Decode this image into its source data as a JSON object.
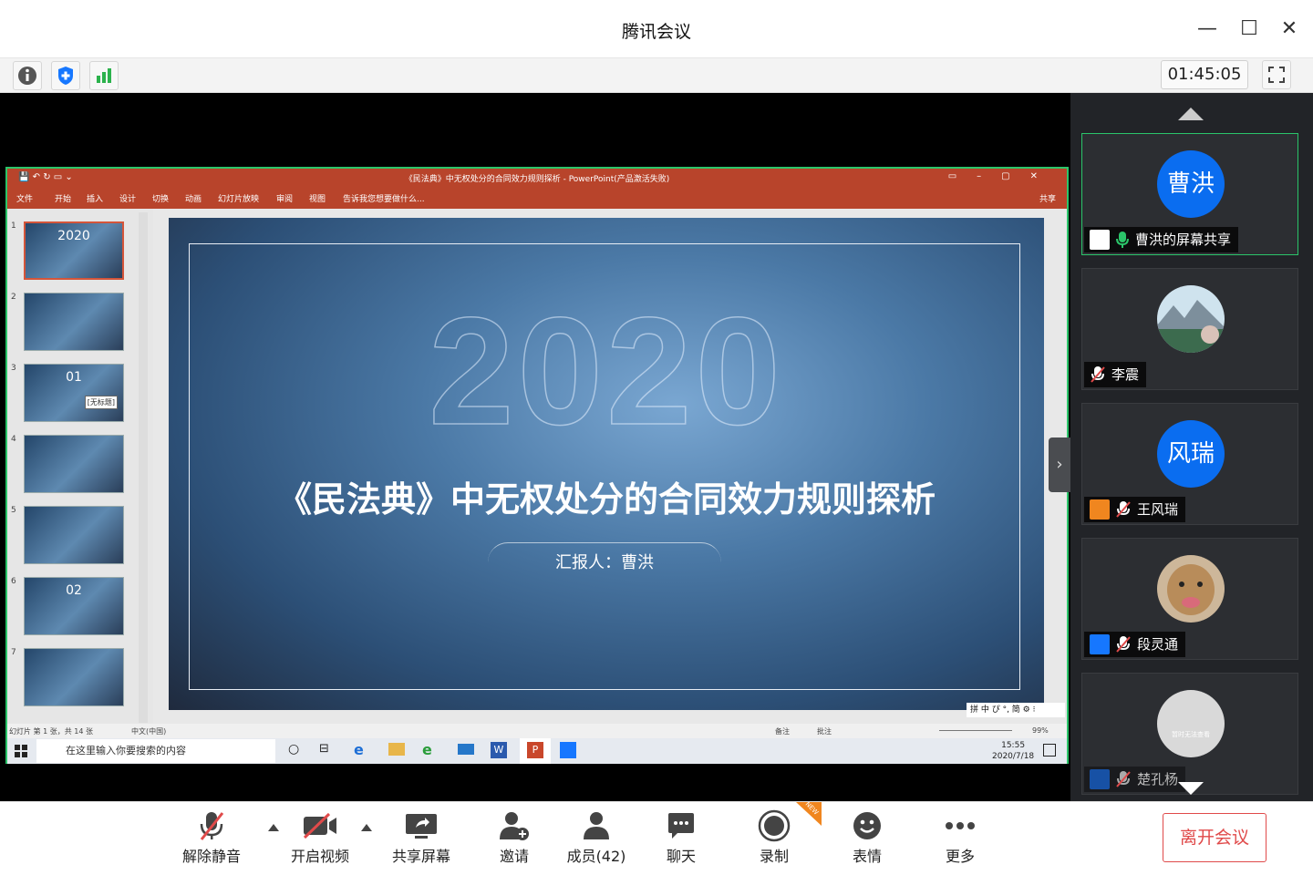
{
  "window": {
    "title": "腾讯会议"
  },
  "infobar": {
    "timer": "01:45:05"
  },
  "ppt": {
    "window_title": "《民法典》中无权处分的合同效力规则探析 - PowerPoint(产品激活失败)",
    "ribbon_tabs": [
      "文件",
      "开始",
      "插入",
      "设计",
      "切换",
      "动画",
      "幻灯片放映",
      "审阅",
      "视图"
    ],
    "tell_me": "告诉我您想要做什么...",
    "share": "共享",
    "slide_numbers": [
      "1",
      "2",
      "3",
      "4",
      "5",
      "6",
      "7"
    ],
    "thumb_tooltip": "[无标题]",
    "slide": {
      "year": "2020",
      "heading": "《民法典》中无权处分的合同效力规则探析",
      "reporter": "汇报人：曹洪"
    },
    "status_left": "幻灯片 第 1 张，共 14 张",
    "status_lang": "中文(中国)",
    "status_notes": "备注",
    "status_comments": "批注",
    "zoom": "99%",
    "taskbar_search": "在这里输入你要搜索的内容",
    "clock_time": "15:55",
    "clock_date": "2020/7/18",
    "ime": "拼 中 ぴ °, 简 ⚙ ⁝"
  },
  "participants": [
    {
      "name": "曹洪的屏幕共享",
      "avatar_text": "曹洪",
      "avatar_color": "#0a6df0",
      "active": true
    },
    {
      "name": "李震",
      "avatar_text": "",
      "muted": true
    },
    {
      "name": "王风瑞",
      "avatar_text": "风瑞",
      "avatar_color": "#0a6df0",
      "muted": true
    },
    {
      "name": "段灵通",
      "avatar_text": "",
      "muted": true
    },
    {
      "name": "楚孔杨",
      "avatar_text": "",
      "avatar_caption": "暂时无法查看",
      "muted": true
    }
  ],
  "toolbar": {
    "mute": "解除静音",
    "video": "开启视频",
    "share": "共享屏幕",
    "invite": "邀请",
    "members": "成员(42)",
    "chat": "聊天",
    "record": "录制",
    "record_badge": "NEW",
    "emoji": "表情",
    "more": "更多",
    "leave": "离开会议"
  }
}
